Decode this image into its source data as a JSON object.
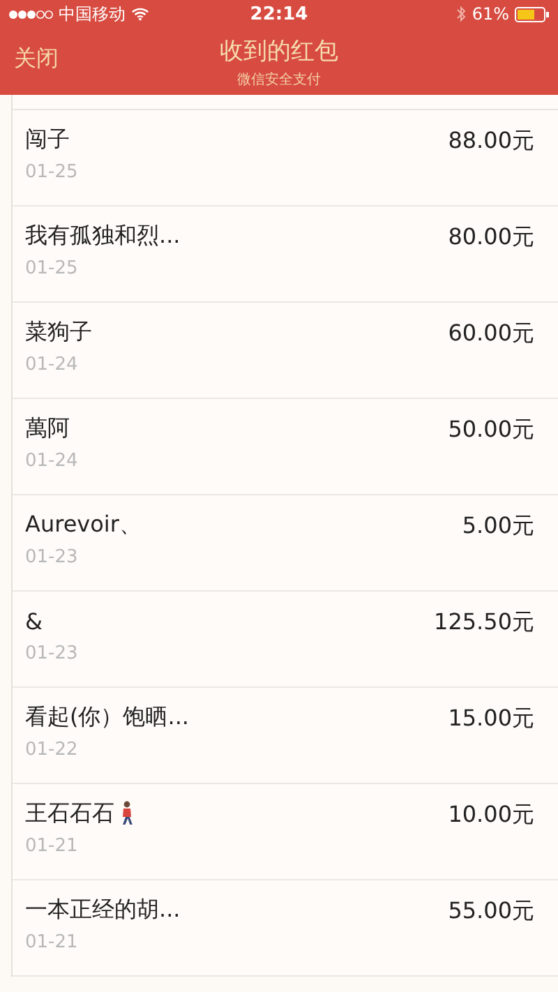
{
  "status_bar": {
    "carrier": "中国移动",
    "time": "22:14",
    "battery": "61%"
  },
  "nav": {
    "close": "关闭",
    "title": "收到的红包",
    "subtitle": "微信安全支付"
  },
  "rows": [
    {
      "name": "闯子",
      "date": "01-25",
      "amount": "88.00元",
      "trailing_icon": false
    },
    {
      "name": "我有孤独和烈...",
      "date": "01-25",
      "amount": "80.00元",
      "trailing_icon": false
    },
    {
      "name": "菜狗子",
      "date": "01-24",
      "amount": "60.00元",
      "trailing_icon": false
    },
    {
      "name": "萬阿",
      "date": "01-24",
      "amount": "50.00元",
      "trailing_icon": false
    },
    {
      "name": "Aurevoir、",
      "date": "01-23",
      "amount": "5.00元",
      "trailing_icon": false
    },
    {
      "name": "&",
      "date": "01-23",
      "amount": "125.50元",
      "trailing_icon": false
    },
    {
      "name": "看起(你）饱晒...",
      "date": "01-22",
      "amount": "15.00元",
      "trailing_icon": false
    },
    {
      "name": "王石石石",
      "date": "01-21",
      "amount": "10.00元",
      "trailing_icon": true
    },
    {
      "name": "一本正经的胡...",
      "date": "01-21",
      "amount": "55.00元",
      "trailing_icon": false
    }
  ]
}
